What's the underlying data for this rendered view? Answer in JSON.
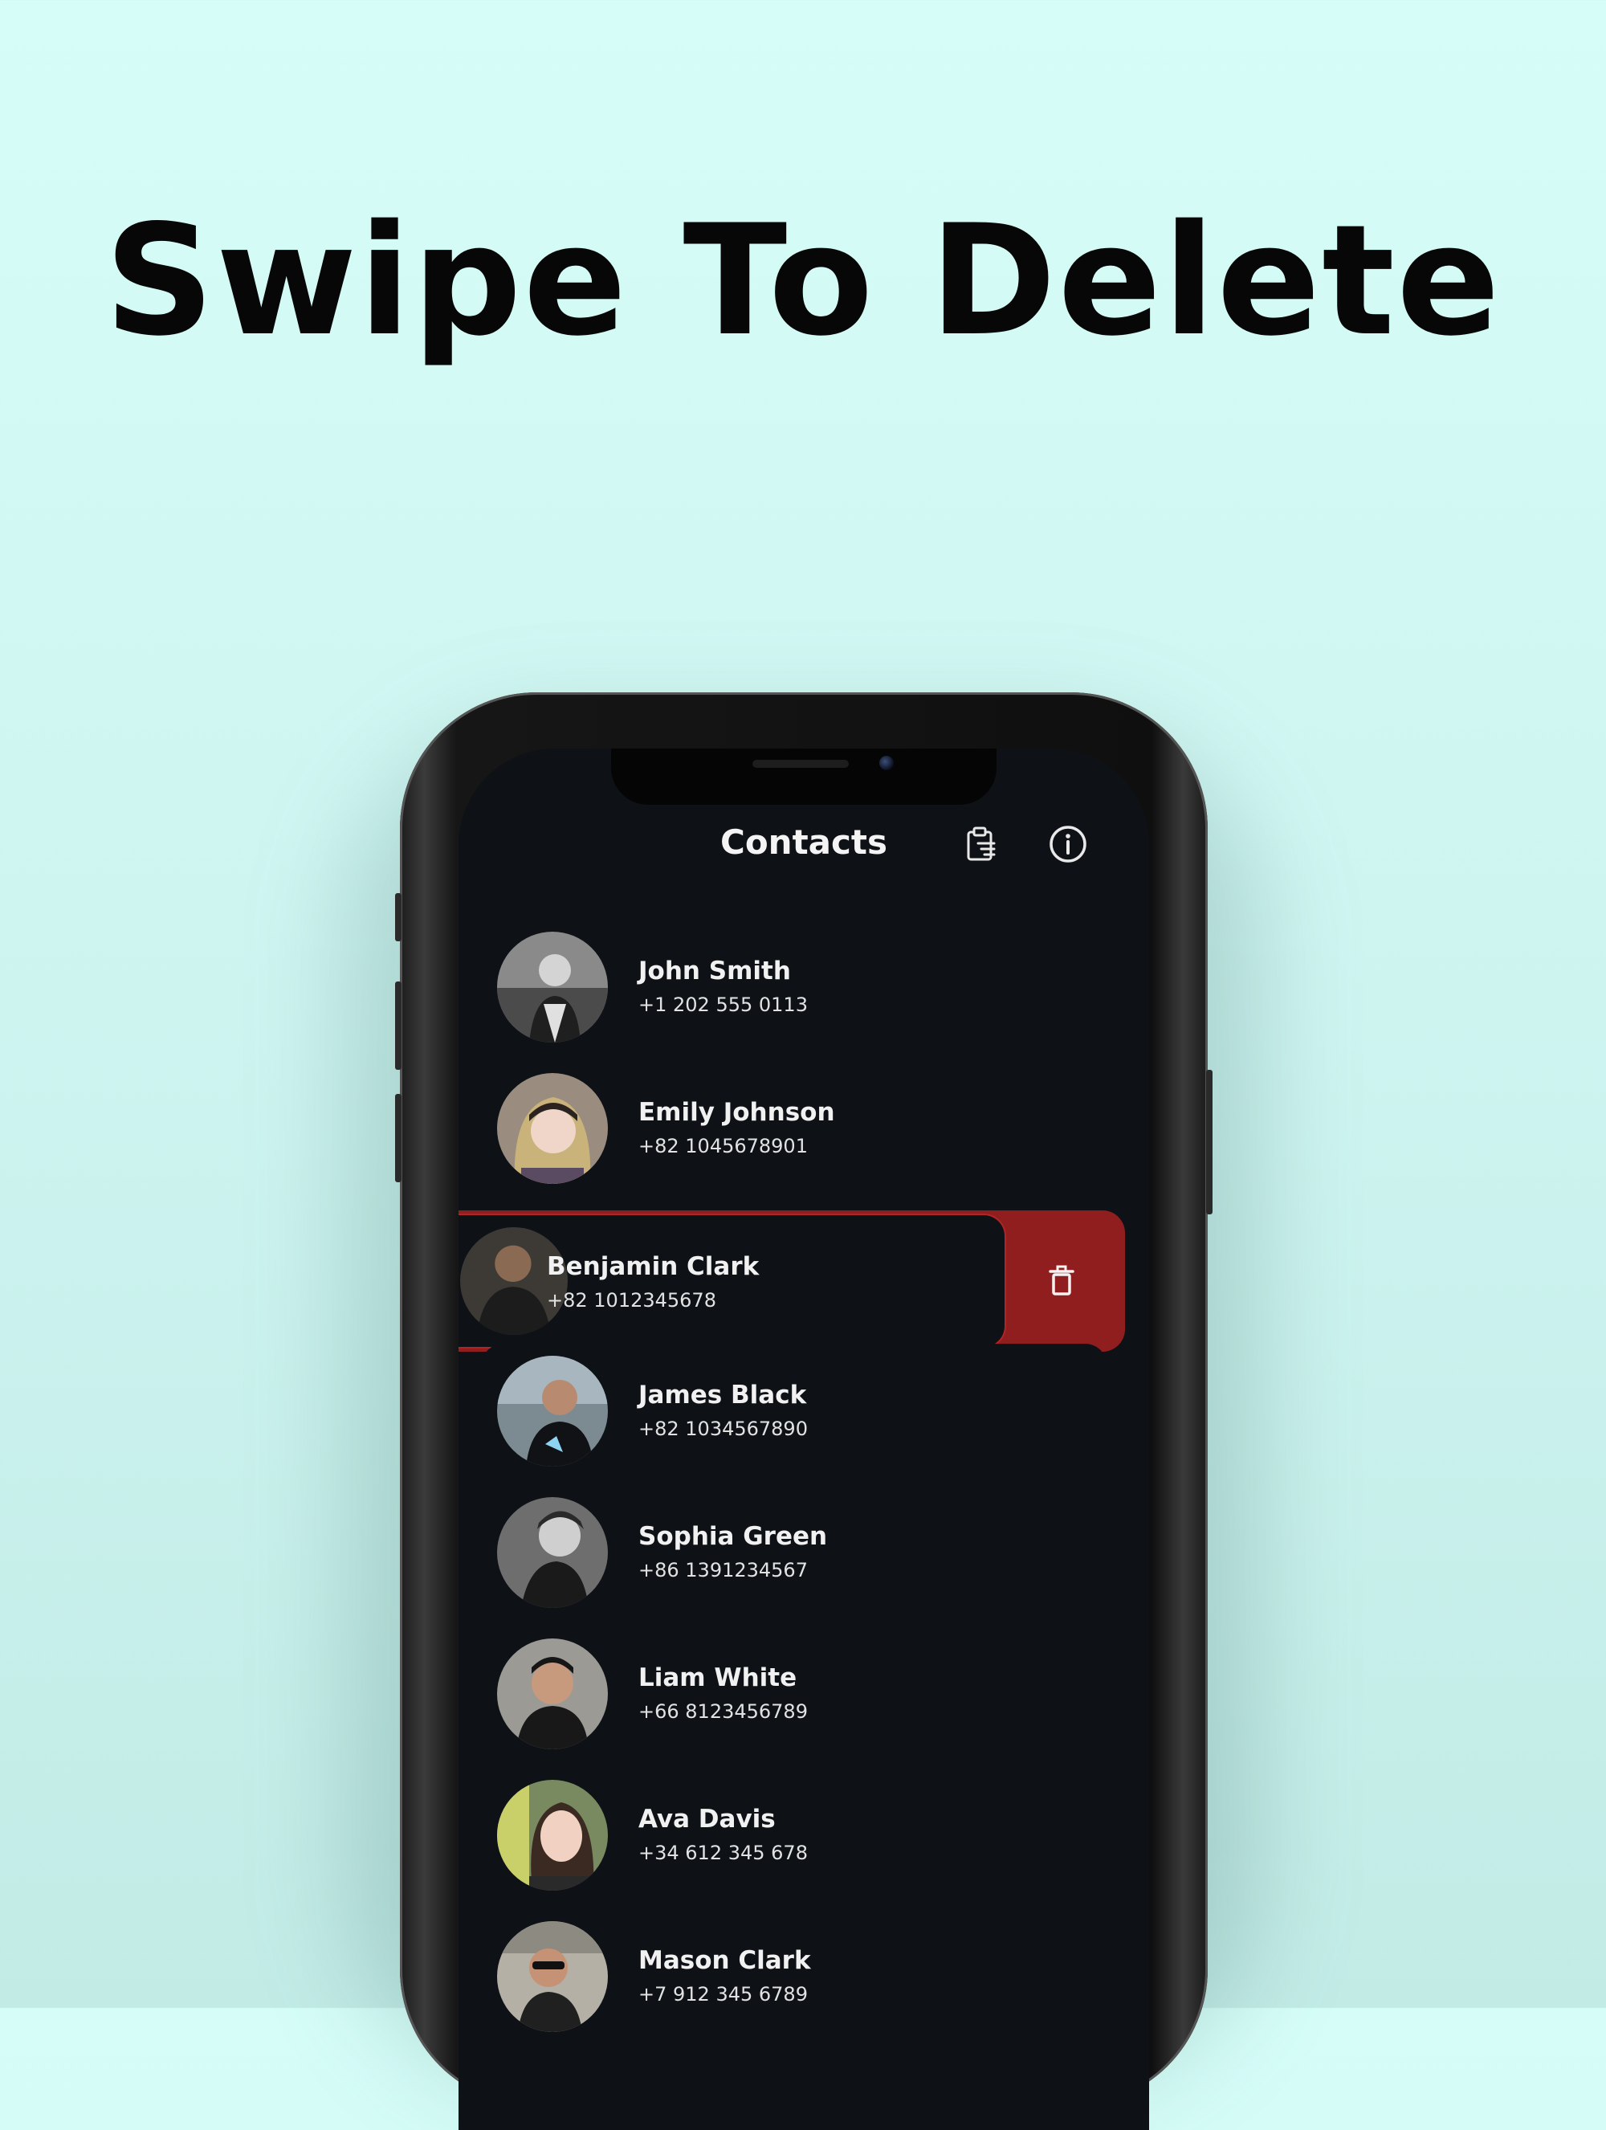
{
  "headline": "Swipe To Delete",
  "app": {
    "title": "Contacts",
    "toolbar": {
      "clear_icon": "clipboard-clear-icon",
      "info_icon": "info-icon"
    }
  },
  "contacts": [
    {
      "name": "John Smith",
      "phone": "+1 202 555 0113"
    },
    {
      "name": "Emily Johnson",
      "phone": "+82 1045678901"
    },
    {
      "name": "Benjamin Clark",
      "phone": "+82 1012345678"
    },
    {
      "name": "James Black",
      "phone": "+82 1034567890"
    },
    {
      "name": "Sophia Green",
      "phone": "+86 1391234567"
    },
    {
      "name": "Liam White",
      "phone": "+66 8123456789"
    },
    {
      "name": "Ava Davis",
      "phone": "+34 612 345 678"
    },
    {
      "name": "Mason Clark",
      "phone": "+7 912 345 6789"
    }
  ],
  "swiped_index": 2,
  "delete_action": {
    "icon": "trash-icon",
    "color": "#911e1e"
  },
  "colors": {
    "background": "#d6fdf8",
    "screen": "#0e1217",
    "text": "#f1f1f1",
    "accent_delete": "#911e1e"
  }
}
